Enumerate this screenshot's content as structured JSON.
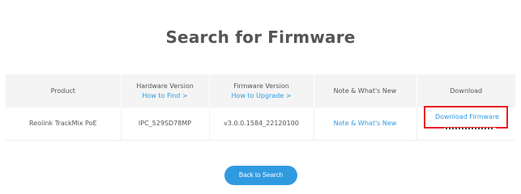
{
  "page": {
    "title": "Search for Firmware"
  },
  "table": {
    "headers": {
      "product": "Product",
      "hardware_version": "Hardware Version",
      "how_to_find": "How to Find >",
      "firmware_version": "Firmware Version",
      "how_to_upgrade": "How to Upgrade >",
      "notes": "Note & What's New",
      "download": "Download"
    },
    "rows": [
      {
        "product": "Reolink TrackMix PoE",
        "hardware_version": "IPC_529SD78MP",
        "firmware_version": "v3.0.0.1584_22120100",
        "notes_link": "Note & What's New",
        "download_link": "Download Firmware"
      }
    ]
  },
  "actions": {
    "back_label": "Back to Search"
  },
  "colors": {
    "link": "#2f9ae0",
    "highlight_box": "#ea1c24",
    "header_bg": "#f4f4f4"
  }
}
